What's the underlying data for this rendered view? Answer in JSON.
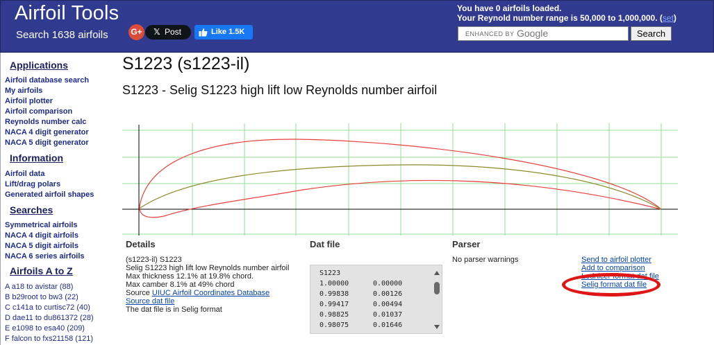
{
  "header": {
    "title": "Airfoil Tools",
    "subtitle": "Search 1638 airfoils",
    "gplus_label": "G+",
    "xpost_logo": "𝕏",
    "xpost_label": "Post",
    "fb_like_label": "Like 1.5K",
    "loaded_text": "You have 0 airfoils loaded.",
    "reynolds_text": "Your Reynold number range is 50,000 to 1,000,000. (",
    "reynolds_link": "set",
    "reynolds_close": ")",
    "search_enhanced": "ENHANCED BY",
    "search_google": "Google",
    "search_button": "Search"
  },
  "sidebar": {
    "sections": [
      {
        "heading": "Applications",
        "items": [
          "Airfoil database search",
          "My airfoils",
          "Airfoil plotter",
          "Airfoil comparison",
          "Reynolds number calc",
          "NACA 4 digit generator",
          "NACA 5 digit generator"
        ]
      },
      {
        "heading": "Information",
        "items": [
          "Airfoil data",
          "Lift/drag polars",
          "Generated airfoil shapes"
        ]
      },
      {
        "heading": "Searches",
        "items": [
          "Symmetrical airfoils",
          "NACA 4 digit airfoils",
          "NACA 5 digit airfoils",
          "NACA 6 series airfoils"
        ]
      },
      {
        "heading": "Airfoils A to Z",
        "items": [
          "A a18 to avistar (88)",
          "B b29root to bw3 (22)",
          "C c141a to curtisc72 (40)",
          "D dae11 to du861372 (28)",
          "E e1098 to esa40 (209)",
          "F falcon to fxs21158 (121)"
        ]
      }
    ]
  },
  "main": {
    "title": "S1223 (s1223-il)",
    "subtitle": "S1223 - Selig S1223 high lift low Reynolds number airfoil",
    "details": {
      "heading": "Details",
      "lines": [
        "(s1223-il) S1223",
        "Selig S1223 high lift low Reynolds number airfoil",
        "Max thickness 12.1% at 19.8% chord.",
        "Max camber 8.1% at 49% chord"
      ],
      "source_prefix": "Source ",
      "source_link": "UIUC Airfoil Coordinates Database",
      "source_dat_link": "Source dat file",
      "format_note": "The dat file is in Selig format"
    },
    "datfile": {
      "heading": "Dat file",
      "name": "S1223",
      "rows": [
        [
          "1.00000",
          "0.00000"
        ],
        [
          "0.99838",
          "0.00126"
        ],
        [
          "0.99417",
          "0.00494"
        ],
        [
          "0.98825",
          "0.01037"
        ],
        [
          "0.98075",
          "0.01646"
        ]
      ]
    },
    "parser": {
      "heading": "Parser",
      "message": "No parser warnings"
    },
    "actions": [
      "Send to airfoil plotter",
      "Add to comparison",
      "Lednicer format dat file",
      "Selig format dat file"
    ]
  },
  "colors": {
    "header_bg": "#303a8f",
    "outline_line": "#e8403a",
    "camber_line": "#8a8a2a",
    "grid": "#90e090",
    "highlight_circle": "#e01616"
  }
}
